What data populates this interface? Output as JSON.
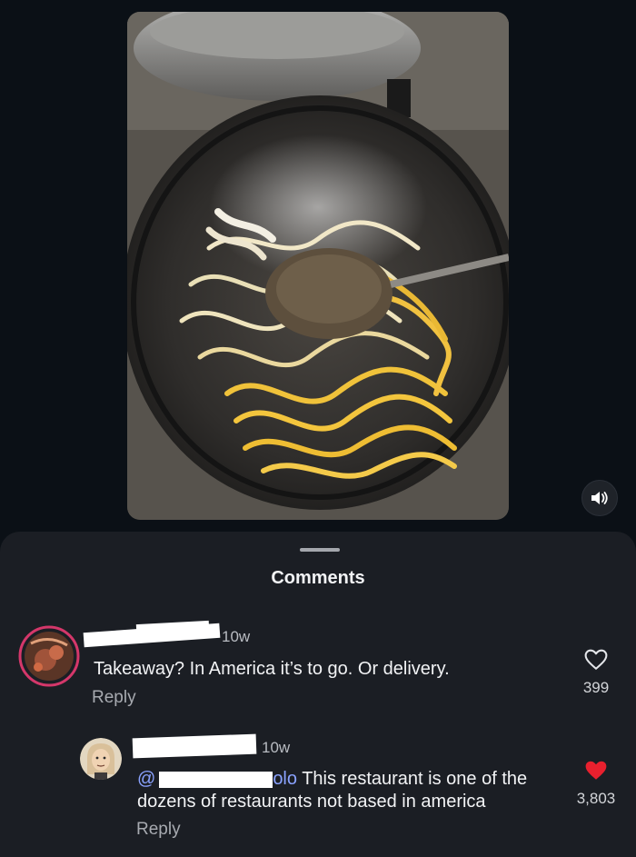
{
  "sheet": {
    "title": "Comments"
  },
  "comments": [
    {
      "author": "",
      "time": "10w",
      "text": "Takeaway? In America it’s to go. Or delivery.",
      "reply_label": "Reply",
      "likes": "399",
      "liked": false
    },
    {
      "author": "",
      "time": "10w",
      "mention_prefix": "@",
      "mention_tail": "olo",
      "text_line1": "This restaurant is one of the",
      "text_line2": "dozens of restaurants not based in america",
      "reply_label": "Reply",
      "likes": "3,803",
      "liked": true
    }
  ],
  "icons": {
    "mute": "speaker-icon",
    "like": "heart-outline-icon",
    "liked": "heart-filled-icon"
  },
  "colors": {
    "background": "#0b1016",
    "sheet": "#1b1e24",
    "mention": "#8aa2ff",
    "liked_heart": "#e8202e",
    "avatar_ring": "#d4376a"
  }
}
